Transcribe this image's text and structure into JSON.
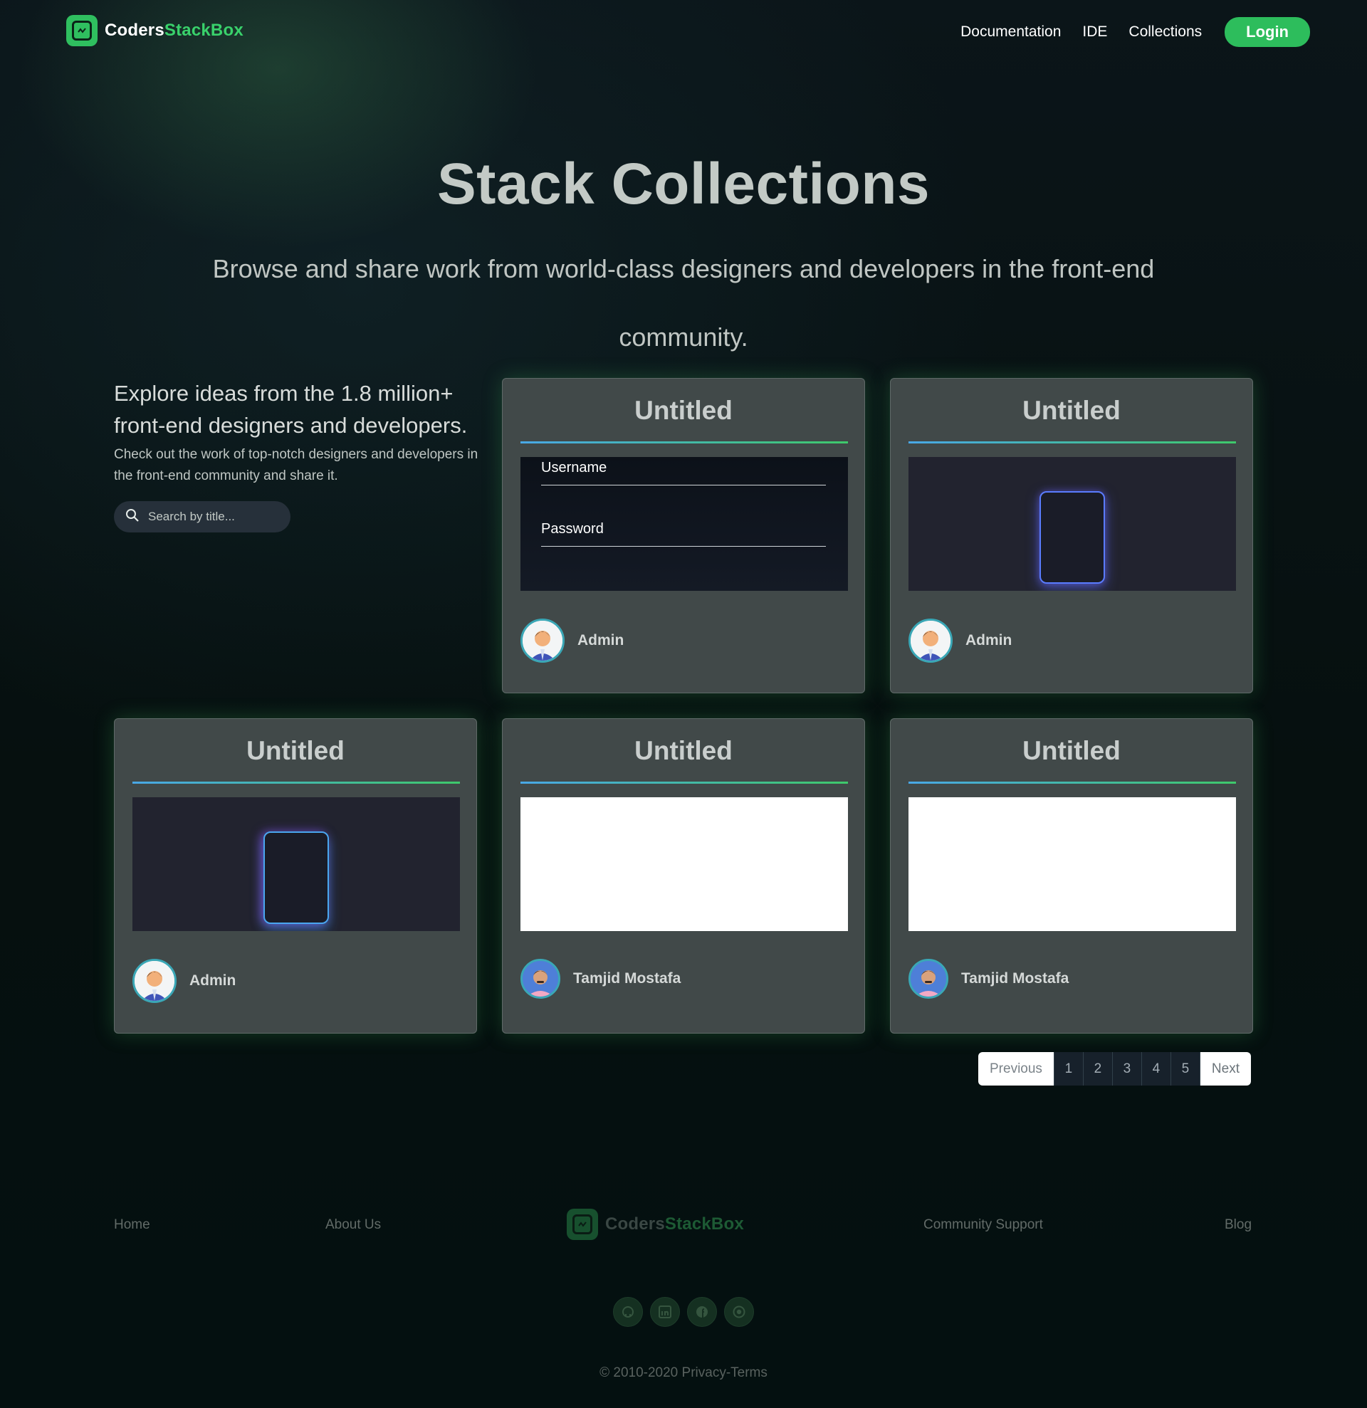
{
  "header": {
    "logo_part1": "Coders",
    "logo_part2": "StackBox",
    "nav": [
      "Documentation",
      "IDE",
      "Collections"
    ],
    "login_label": "Login"
  },
  "hero": {
    "title": "Stack Collections",
    "subtitle": "Browse and share work from world-class designers and developers in the front-end community."
  },
  "explore": {
    "heading": "Explore ideas from the 1.8 million+ front-end designers and developers.",
    "text": "Check out the work of top-notch designers and developers in the front-end community and share it.",
    "search_placeholder": "Search by title..."
  },
  "cards": [
    {
      "title": "Untitled",
      "author": "Admin",
      "preview": "login-form",
      "form_labels": [
        "Username",
        "Password"
      ]
    },
    {
      "title": "Untitled",
      "author": "Admin",
      "preview": "glow-box"
    },
    {
      "title": "Untitled",
      "author": "Admin",
      "preview": "glow-box"
    },
    {
      "title": "Untitled",
      "author": "Tamjid Mostafa",
      "preview": "blank"
    },
    {
      "title": "Untitled",
      "author": "Tamjid Mostafa",
      "preview": "blank"
    }
  ],
  "pagination": {
    "previous": "Previous",
    "pages": [
      "1",
      "2",
      "3",
      "4",
      "5"
    ],
    "next": "Next"
  },
  "footer": {
    "links": [
      "Home",
      "About Us",
      "Community Support",
      "Blog"
    ],
    "socials": [
      "github-icon",
      "linkedin-icon",
      "facebook-icon",
      "instagram-icon"
    ],
    "copyright": "2010-2020 Privacy-Terms"
  },
  "colors": {
    "accent": "#2dbd5c",
    "card_bg": "#414949",
    "background": "#06100f"
  }
}
